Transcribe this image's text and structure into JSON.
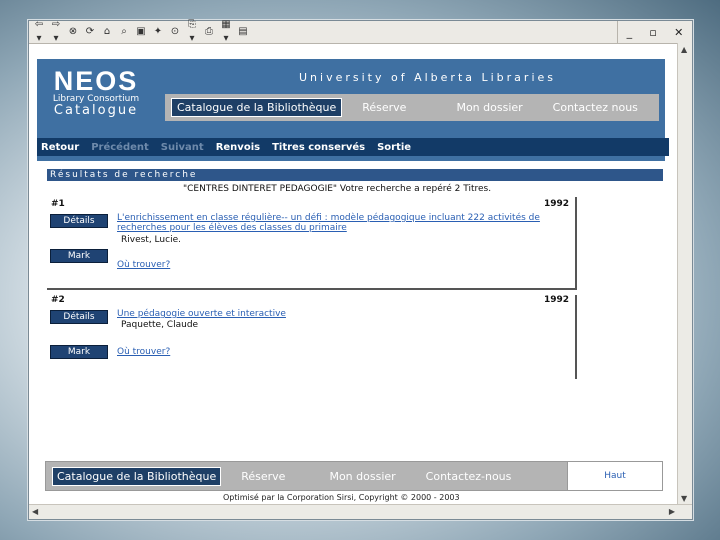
{
  "toolbar": {
    "buttons": [
      "⇦ ▾",
      "⇨ ▾",
      "⊗",
      "⟳",
      "⌂",
      "⌕",
      "▣",
      "✦",
      "⊙",
      "⎘ ▾",
      "⎙",
      "▦ ▾",
      "▤"
    ],
    "icons": [
      "back-icon",
      "forward-icon",
      "stop-icon",
      "refresh-icon",
      "home-icon",
      "search-icon",
      "favorites-icon",
      "history-icon",
      "media-icon",
      "mail-icon",
      "print-icon",
      "edit-icon",
      "discuss-icon"
    ]
  },
  "window_controls": {
    "minimize": "_",
    "restore": "▫",
    "close": "✕"
  },
  "header": {
    "logo_main": "NEOS",
    "logo_sub": "Library Consortium",
    "logo_catalogue": "Catalogue",
    "university": "University of Alberta Libraries"
  },
  "top_nav": {
    "items": [
      "Catalogue de la Bibliothèque",
      "Réserve",
      "Mon dossier",
      "Contactez nous"
    ]
  },
  "command_bar": {
    "items": [
      "Retour",
      "Précédent",
      "Suivant",
      "Renvois",
      "Titres conservés",
      "Sortie"
    ]
  },
  "results": {
    "heading": "Résultats de recherche",
    "query": "\"CENTRES DINTERET PEDAGOGIE\" Votre recherche a repéré 2 Titres.",
    "records": [
      {
        "number": "#1",
        "year": "1992",
        "title": "L'enrichissement en classe régulière-- un défi : modèle pédagogique incluant 222 activités de recherches pour les élèves des classes du primaire",
        "author": "Rivest, Lucie.",
        "details_label": "Détails",
        "mark_label": "Mark",
        "where_label": "Où trouver?"
      },
      {
        "number": "#2",
        "year": "1992",
        "title": "Une pédagogie ouverte et interactive",
        "author": "Paquette, Claude",
        "details_label": "Détails",
        "mark_label": "Mark",
        "where_label": "Où trouver?"
      }
    ]
  },
  "bottom_nav": {
    "items": [
      "Catalogue de la Bibliothèque",
      "Réserve",
      "Mon dossier",
      "Contactez-nous"
    ],
    "top_link": "Haut"
  },
  "footer": {
    "copyright": "Optimisé par la Corporation Sirsi, Copyright © 2000 - 2003"
  },
  "colors": {
    "banner": "#3f70a2",
    "command_bar": "#123a67",
    "button": "#1f4373",
    "link": "#2a5fb3"
  }
}
